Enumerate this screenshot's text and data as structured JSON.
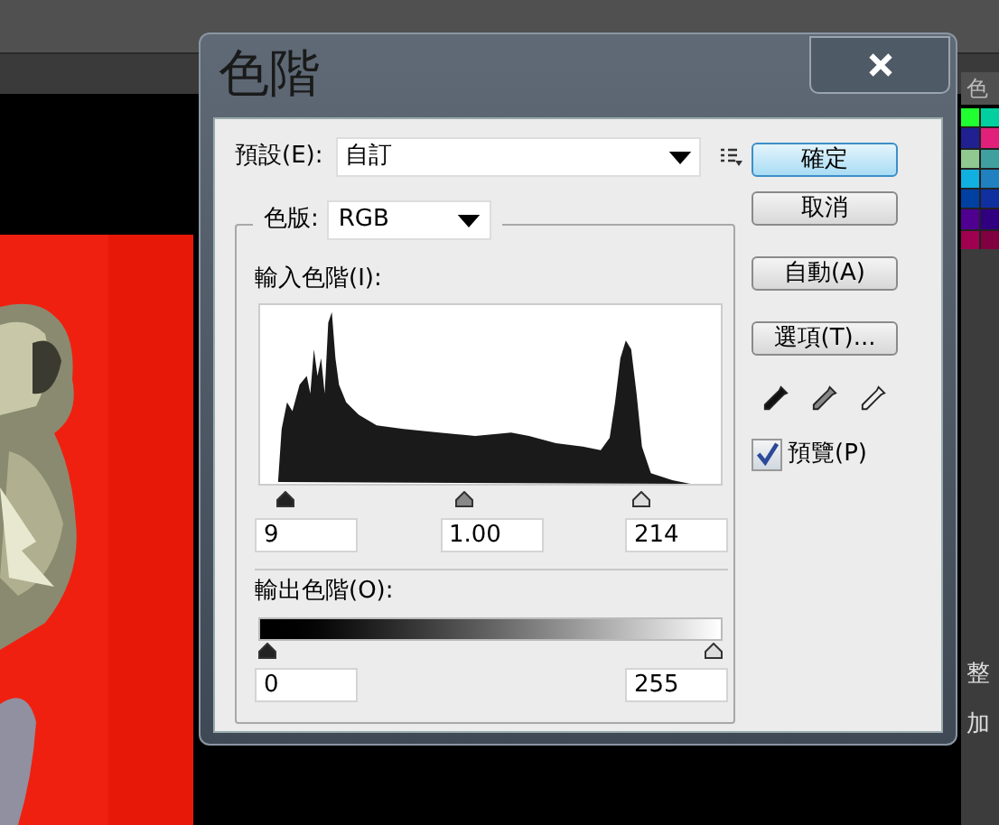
{
  "background": {
    "panel_tab": "色",
    "panel_labels": [
      "整",
      "加"
    ]
  },
  "dialog": {
    "title": "色階",
    "preset": {
      "label": "預設(E):",
      "value": "自訂"
    },
    "channel": {
      "label": "色版:",
      "value": "RGB"
    },
    "input_levels": {
      "label": "輸入色階(I):",
      "handles": [
        {
          "kind": "black",
          "level": 0.04
        },
        {
          "kind": "gray",
          "level": 0.44
        },
        {
          "kind": "white",
          "level": 0.84
        }
      ],
      "values": [
        "9",
        "1.00",
        "214"
      ]
    },
    "output_levels": {
      "label": "輸出色階(O):",
      "handles": [
        {
          "kind": "black",
          "level": 0
        },
        {
          "kind": "white",
          "level": 1
        }
      ],
      "values": [
        "0",
        "255"
      ]
    },
    "buttons": [
      {
        "label": "確定",
        "default": true
      },
      {
        "label": "取消",
        "default": false
      },
      {
        "label": "自動(A)",
        "default": false
      },
      {
        "label": "選項(T)...",
        "default": false
      }
    ],
    "preview": {
      "label": "預覽(P)",
      "checked": true
    }
  }
}
